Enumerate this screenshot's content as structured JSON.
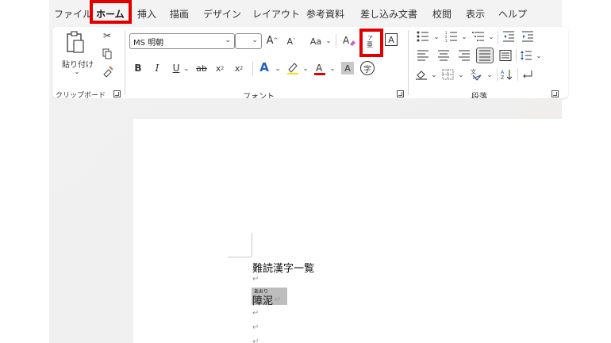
{
  "tabs": [
    {
      "label": "ファイル",
      "active": false
    },
    {
      "label": "ホーム",
      "active": true
    },
    {
      "label": "挿入",
      "active": false
    },
    {
      "label": "描画",
      "active": false
    },
    {
      "label": "デザイン",
      "active": false
    },
    {
      "label": "レイアウト",
      "active": false
    },
    {
      "label": "参考資料",
      "active": false
    },
    {
      "label": "差し込み文書",
      "active": false
    },
    {
      "label": "校閲",
      "active": false
    },
    {
      "label": "表示",
      "active": false
    },
    {
      "label": "ヘルプ",
      "active": false
    }
  ],
  "clipboard": {
    "paste_label": "貼り付け",
    "group_label": "クリップボード"
  },
  "font": {
    "font_name": "MS 明朝",
    "font_size": "",
    "group_label": "フォント",
    "aa_label": "Aa"
  },
  "paragraph": {
    "group_label": "段落"
  },
  "highlight_color": "#e00000",
  "document": {
    "heading": "難読漢字一覧",
    "selected_word": "障泥",
    "ruby_reading": "あおり",
    "para_mark": "↵"
  }
}
